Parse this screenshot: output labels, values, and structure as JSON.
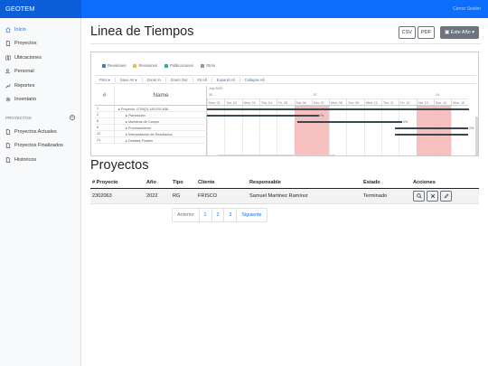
{
  "app": {
    "brand": "GEOTEM",
    "logout_label": "Cerrar Sesión"
  },
  "sidebar": {
    "items": [
      {
        "label": "Inicio",
        "icon": "home-icon",
        "active": true
      },
      {
        "label": "Proyectos",
        "icon": "file-icon"
      },
      {
        "label": "Ubicaciones",
        "icon": "map-icon"
      },
      {
        "label": "Personal",
        "icon": "users-icon"
      },
      {
        "label": "Reportes",
        "icon": "chart-icon"
      },
      {
        "label": "Inventario",
        "icon": "gear-icon"
      }
    ],
    "section_title": "PROYECTOS",
    "section_items": [
      {
        "label": "Proyectos Actuales",
        "icon": "file-icon"
      },
      {
        "label": "Proyectos Finalizados",
        "icon": "file-icon"
      },
      {
        "label": "Historicos",
        "icon": "file-icon"
      }
    ]
  },
  "main": {
    "title": "Linea de Tiempos",
    "export_buttons": [
      "CSV",
      "PDF"
    ],
    "range_button": "Este Año",
    "gantt": {
      "legend": [
        {
          "label": "Revisiones",
          "color": "#4a7fb5"
        },
        {
          "label": "Revisiones",
          "color": "#e2c24a"
        },
        {
          "label": "Publicaciones",
          "color": "#3aa6a0"
        },
        {
          "label": "Otros",
          "color": "#999999"
        }
      ],
      "toolbar": [
        "Print ▾",
        "Save As ▾",
        "Zoom In",
        "Zoom Out",
        "Fit All",
        "Expand All",
        "Collapse All"
      ],
      "col_num": "#",
      "col_name": "Name",
      "month_label": "July 2020",
      "weeks": [
        "30",
        "07",
        "14"
      ],
      "days": [
        "Mon, 01",
        "Tue, 02",
        "Wed, 03",
        "Thu, 04",
        "Fri, 05",
        "Sat, 06",
        "Sun, 07",
        "Mon, 08",
        "Tue, 09",
        "Wed, 10",
        "Thu, 11",
        "Fri, 12",
        "Sat, 13",
        "Sun, 14",
        "Mon, 15"
      ],
      "rows": [
        {
          "num": "1",
          "name": "Proyecto: GTM(2)-183-RG-836",
          "indent": 0
        },
        {
          "num": "2",
          "name": "Planeación",
          "indent": 1
        },
        {
          "num": "6",
          "name": "Muestras de Campo",
          "indent": 1
        },
        {
          "num": "9",
          "name": "Procesamiento",
          "indent": 1
        },
        {
          "num": "12",
          "name": "Interpretación de Resultados",
          "indent": 1
        },
        {
          "num": "21",
          "name": "Detalles Finales",
          "indent": 1
        }
      ],
      "bars": [
        {
          "row": 0,
          "start": 0,
          "end": 15,
          "label": ""
        },
        {
          "row": 1,
          "start": 0,
          "end": 6.4,
          "label": "0%"
        },
        {
          "row": 2,
          "start": 5.2,
          "end": 11.2,
          "label": "0%"
        },
        {
          "row": 3,
          "start": 10.8,
          "end": 15,
          "label": "0%"
        },
        {
          "row": 4,
          "start": 10.8,
          "end": 15,
          "label": ""
        }
      ]
    },
    "projects_title": "Proyectos",
    "table": {
      "headers": [
        "# Proyecto",
        "Año",
        "Tipo",
        "Cliente",
        "Responsable",
        "Estado",
        "Acciones"
      ],
      "rows": [
        [
          "2302063",
          "2022",
          "RG",
          "FRISCO",
          "Samuel Martinez Ramírez",
          "Terminado"
        ]
      ]
    },
    "pagination": [
      "Anterior",
      "1",
      "2",
      "3",
      "Siguiente"
    ]
  }
}
